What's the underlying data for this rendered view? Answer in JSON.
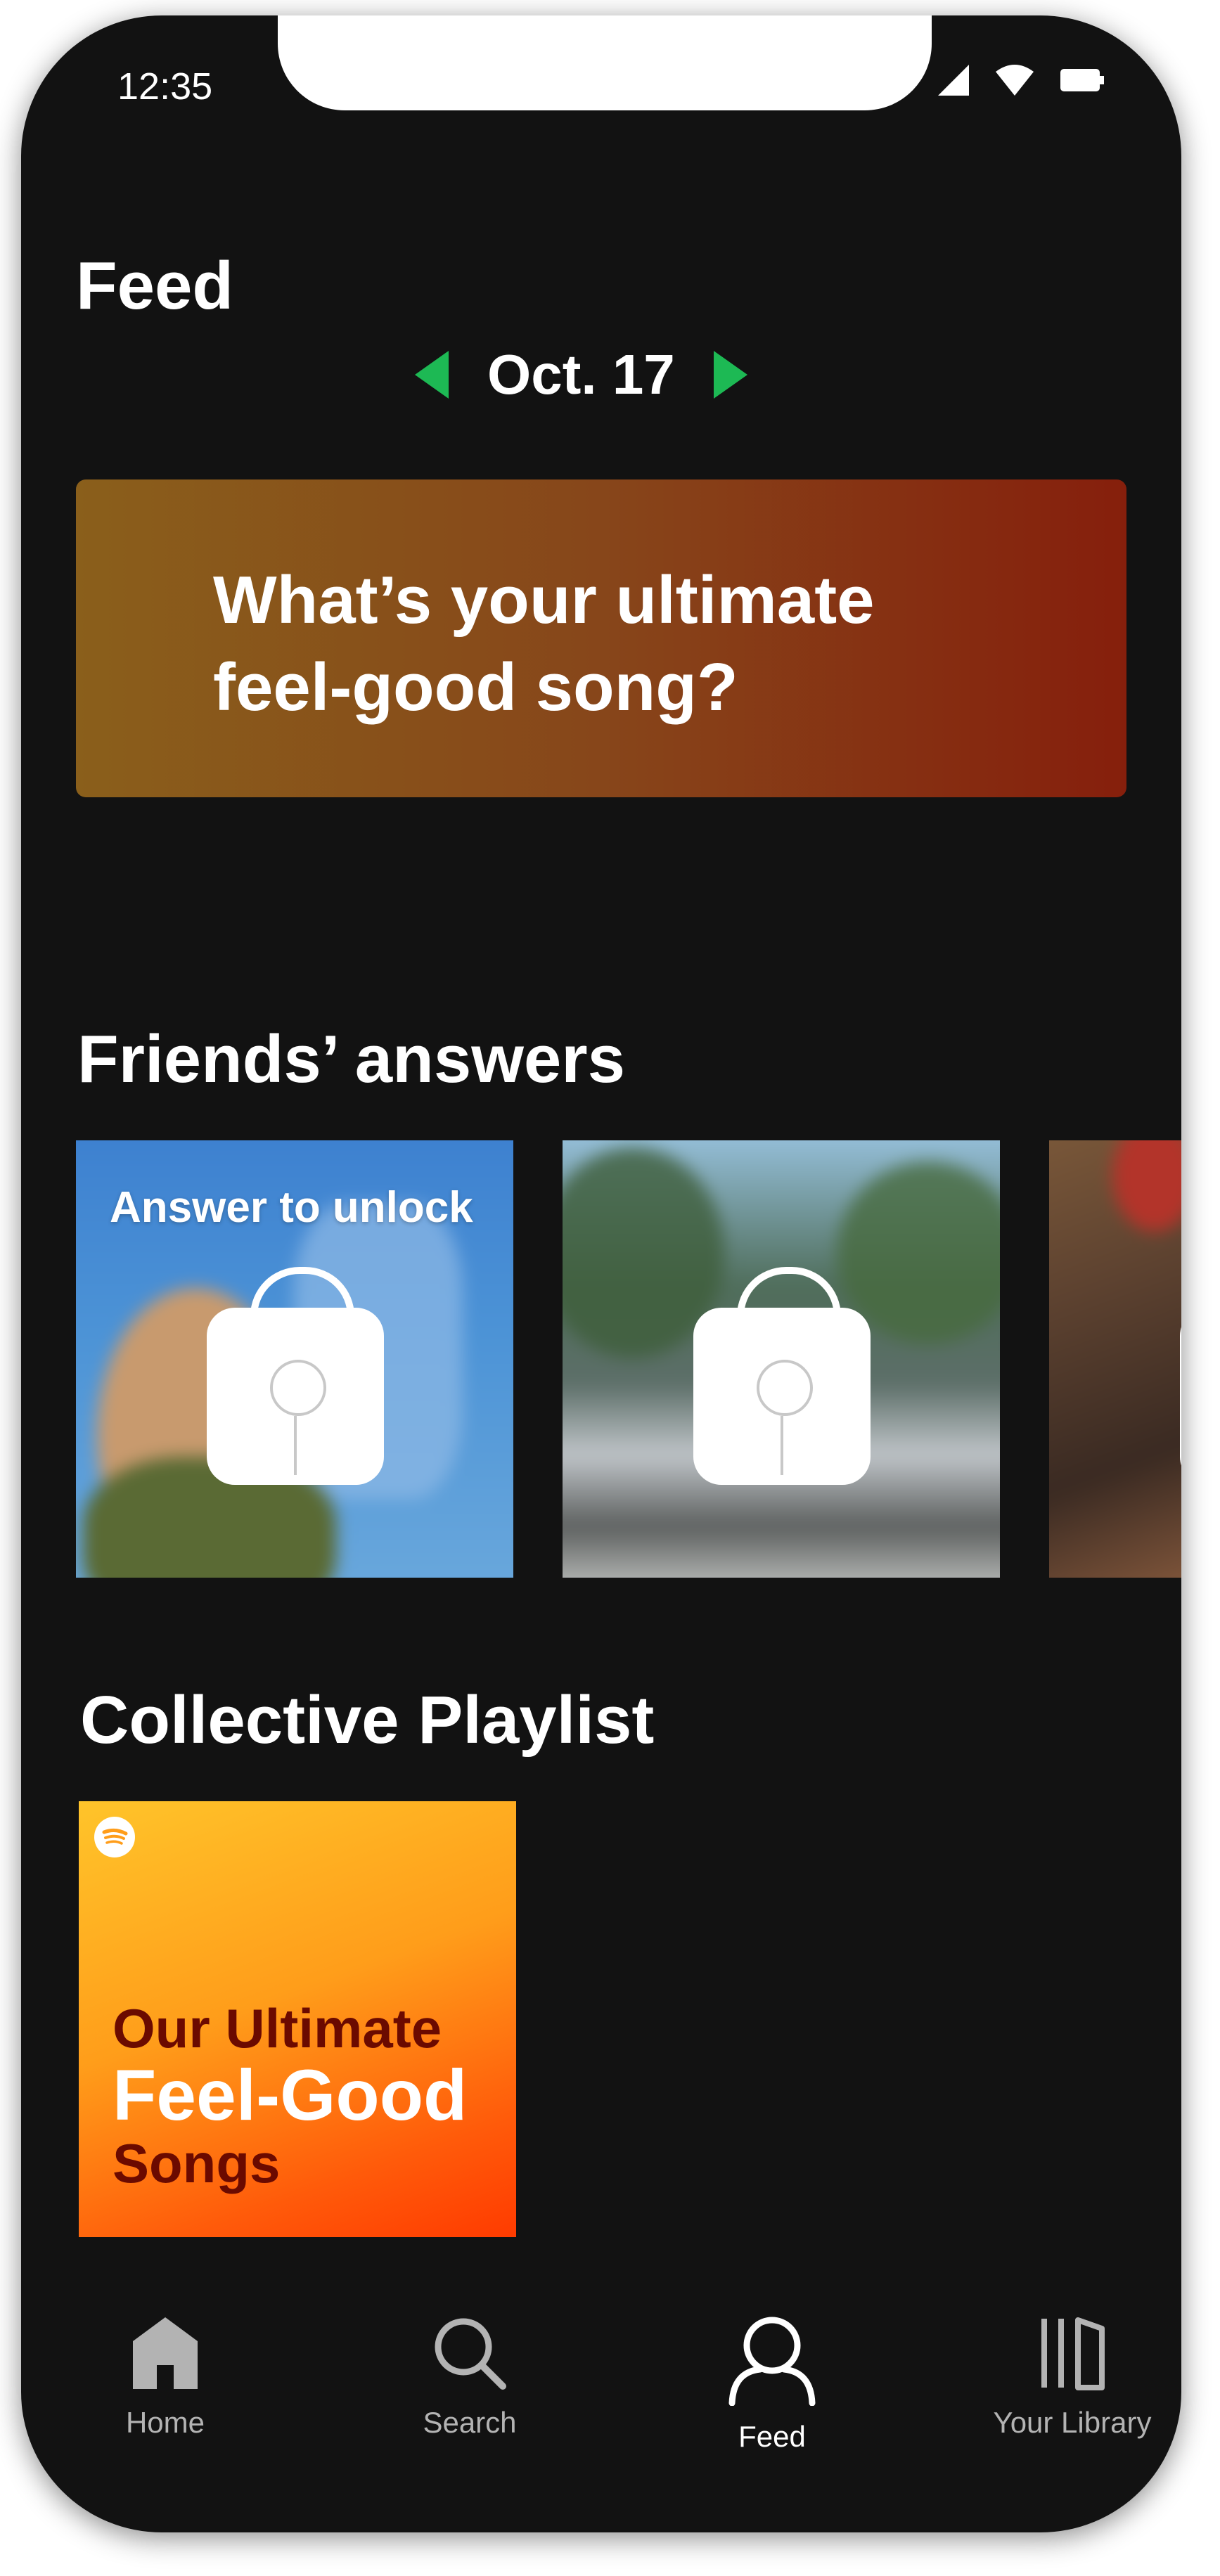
{
  "status_bar": {
    "time": "12:35"
  },
  "header": {
    "title": "Feed",
    "date": "Oct. 17"
  },
  "prompt": {
    "question": "What’s your ultimate feel-good song?"
  },
  "friends": {
    "title": "Friends’ answers",
    "overlay_text": "Answer to unlock"
  },
  "collective": {
    "title": "Collective Playlist",
    "playlist": {
      "line1": "Our Ultimate",
      "line2": "Feel-Good",
      "line3": "Songs"
    }
  },
  "nav": {
    "items": [
      {
        "label": "Home",
        "icon": "home-icon"
      },
      {
        "label": "Search",
        "icon": "search-icon"
      },
      {
        "label": "Feed",
        "icon": "user-icon",
        "active": true
      },
      {
        "label": "Your Library",
        "icon": "library-icon"
      }
    ]
  },
  "colors": {
    "background": "#121212",
    "accent": "#1db954",
    "prompt_gradient": [
      "#8a5f1b",
      "#861f0c"
    ],
    "playlist_gradient": [
      "#ffc42a",
      "#ff3b00"
    ]
  }
}
